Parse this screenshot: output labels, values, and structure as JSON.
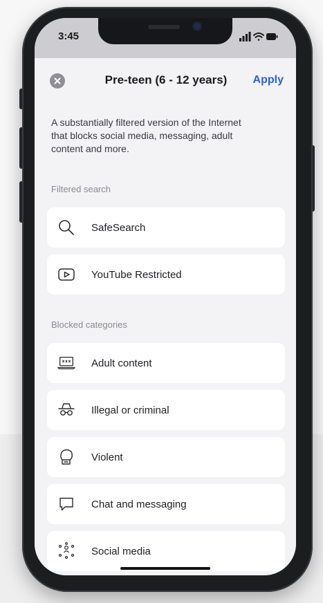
{
  "status_bar": {
    "time": "3:45",
    "icons": [
      "signal-icon",
      "wifi-icon",
      "battery-icon"
    ]
  },
  "header": {
    "close_icon": "close-icon",
    "title": "Pre-teen (6 - 12 years)",
    "apply_label": "Apply"
  },
  "description": "A substantially filtered version of the Internet that blocks social media, messaging, adult content and more.",
  "filtered_search": {
    "label": "Filtered search",
    "items": [
      {
        "label": "SafeSearch",
        "icon": "search-icon"
      },
      {
        "label": "YouTube Restricted",
        "icon": "youtube-icon"
      }
    ]
  },
  "blocked_categories": {
    "label": "Blocked categories",
    "items": [
      {
        "label": "Adult content",
        "icon": "adult-laptop-icon"
      },
      {
        "label": "Illegal or criminal",
        "icon": "spy-icon"
      },
      {
        "label": "Violent",
        "icon": "boxing-glove-icon"
      },
      {
        "label": "Chat and messaging",
        "icon": "chat-bubble-icon"
      },
      {
        "label": "Social media",
        "icon": "social-network-icon"
      }
    ]
  },
  "colors": {
    "accent": "#2a62d6",
    "sheet_background": "#f3f3f5",
    "card_background": "#ffffff",
    "section_label": "#8a8a92"
  }
}
